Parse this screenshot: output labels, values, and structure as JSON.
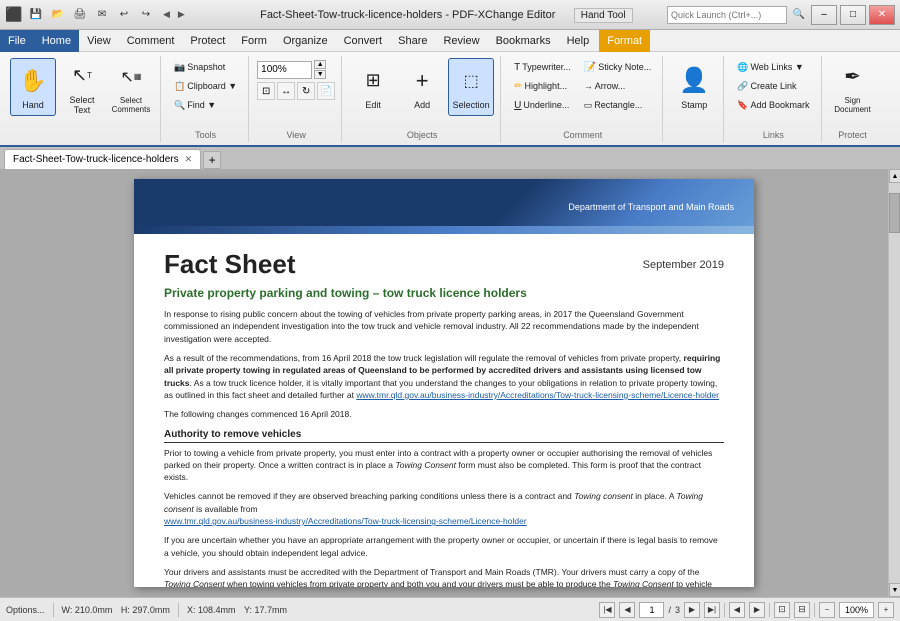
{
  "titleBar": {
    "title": "Fact-Sheet-Tow-truck-licence-holders - PDF-XChange Editor",
    "tool": "Hand Tool",
    "quickLaunch": "Quick Launch (Ctrl+...)",
    "buttons": {
      "minimize": "–",
      "maximize": "□",
      "close": "✕"
    }
  },
  "menuBar": {
    "items": [
      {
        "label": "File",
        "active": false
      },
      {
        "label": "Home",
        "active": true
      },
      {
        "label": "View",
        "active": false
      },
      {
        "label": "Comment",
        "active": false
      },
      {
        "label": "Protect",
        "active": false
      },
      {
        "label": "Form",
        "active": false
      },
      {
        "label": "Organize",
        "active": false
      },
      {
        "label": "Convert",
        "active": false
      },
      {
        "label": "Share",
        "active": false
      },
      {
        "label": "Review",
        "active": false
      },
      {
        "label": "Bookmarks",
        "active": false
      },
      {
        "label": "Help",
        "active": false
      },
      {
        "label": "Format",
        "active": false,
        "highlighted": true
      }
    ]
  },
  "ribbon": {
    "groups": [
      {
        "label": "",
        "buttons": [
          {
            "icon": "✋",
            "label": "Hand",
            "large": true,
            "active": true
          },
          {
            "icon": "↖",
            "label": "Select Text",
            "large": true,
            "active": false
          },
          {
            "icon": "▦",
            "label": "Select Comments",
            "large": true,
            "active": false
          }
        ]
      },
      {
        "label": "Tools",
        "smallButtons": [
          {
            "icon": "📷",
            "label": "Snapshot"
          },
          {
            "icon": "📋",
            "label": "Clipboard ▼"
          },
          {
            "icon": "🔍",
            "label": "Find ▼"
          }
        ]
      },
      {
        "label": "View",
        "zoomLabel": "100%",
        "buttons": []
      },
      {
        "label": "Objects",
        "buttons": [
          {
            "icon": "⊞",
            "label": "Edit",
            "large": true
          },
          {
            "icon": "+",
            "label": "Add",
            "large": true
          },
          {
            "icon": "⬚",
            "label": "Selection",
            "large": true,
            "selected": true
          }
        ]
      },
      {
        "label": "Comment",
        "buttons": [
          {
            "icon": "T",
            "label": "Typewriter..."
          },
          {
            "icon": "✏",
            "label": "Highlight..."
          },
          {
            "icon": "U",
            "label": "Underline..."
          },
          {
            "icon": "📝",
            "label": "Sticky Note..."
          },
          {
            "icon": "→",
            "label": "Arrow..."
          },
          {
            "icon": "▭",
            "label": "Rectangle..."
          }
        ]
      },
      {
        "label": "",
        "buttons": [
          {
            "icon": "👤",
            "label": "Stamp",
            "large": true
          }
        ]
      },
      {
        "label": "Links",
        "buttons": [
          {
            "icon": "🌐",
            "label": "Web Links ▼"
          },
          {
            "icon": "🔗",
            "label": "Create Link"
          },
          {
            "icon": "🔖",
            "label": "Add Bookmark"
          }
        ]
      },
      {
        "label": "Protect",
        "buttons": [
          {
            "icon": "✒",
            "label": "Sign Document",
            "large": true
          }
        ]
      }
    ]
  },
  "docTabs": {
    "tabs": [
      {
        "label": "Fact-Sheet-Tow-truck-licence-holders",
        "active": true
      }
    ],
    "addLabel": "+"
  },
  "pdfDocument": {
    "department": "Department of Transport and Main Roads",
    "title": "Fact Sheet",
    "date": "September 2019",
    "subtitle": "Private property parking and towing – tow truck licence holders",
    "paragraphs": [
      "In response to rising public concern about the towing of vehicles from private property parking areas, in 2017 the Queensland Government commissioned an independent investigation into the tow truck and vehicle removal industry. All 22 recommendations made by the independent investigation were accepted.",
      "As a result of the recommendations, from 16 April 2018 the tow truck legislation will regulate the removal of vehicles from private property, requiring all private property towing in regulated areas of Queensland to be performed by accredited drivers and assistants using licensed tow trucks. As a tow truck licence holder, it is vitally important that you understand the changes to your obligations in relation to private property towing, as outlined in this fact sheet and detailed further at www.tmr.qld.gov.au/business-industry/Accreditations/Tow-truck-licensing-scheme/Licence-holder",
      "The following changes commenced 16 April 2018."
    ],
    "sections": [
      {
        "heading": "Authority to remove vehicles",
        "paragraphs": [
          "Prior to towing a vehicle from private property, you must enter into a contract with a property owner or occupier authorising the removal of vehicles parked on their property. Once a written contract is in place a Towing Consent form must also be completed. This form is proof that the contract exists.",
          "Vehicles cannot be removed if they are observed breaching parking conditions unless there is a contract and Towing consent in place. A Towing consent is available from\nwww.tmr.qld.gov.au/business-industry/Accreditations/Tow-truck-licensing-scheme/Licence-holder",
          "If you are uncertain whether you have an appropriate arrangement with the property owner or occupier, or uncertain if there is legal basis to remove a vehicle, you should obtain independent legal advice.",
          "Your drivers and assistants must be accredited with the Department of Transport and Main Roads (TMR). Your drivers must carry a copy of the Towing Consent when towing vehicles from private property and both you and your drivers must be able to produce the Towing Consent to vehicle owners and authorised officers on request."
        ]
      }
    ]
  },
  "statusBar": {
    "options": "Options...",
    "width": "W: 210.0mm",
    "height": "H: 297.0mm",
    "x": "X: 108.4mm",
    "y": "Y: 17.7mm",
    "currentPage": "1",
    "totalPages": "3",
    "zoom": "100%"
  }
}
